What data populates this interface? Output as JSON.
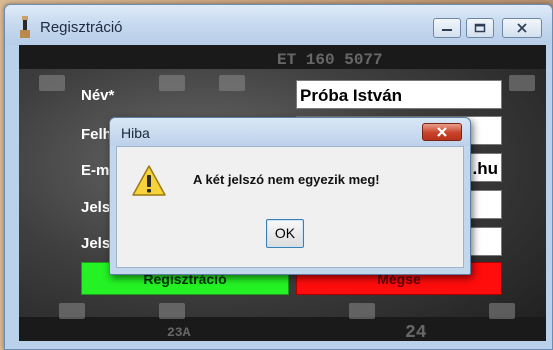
{
  "window": {
    "title": "Regisztráció",
    "icon": "app-icon"
  },
  "form": {
    "fields": [
      {
        "label": "Név*",
        "value": "Próba István"
      },
      {
        "label": "Felh",
        "value": ""
      },
      {
        "label": "E-m",
        "value": ".hu"
      },
      {
        "label": "Jels",
        "value": ""
      },
      {
        "label": "Jels",
        "value": ""
      }
    ],
    "register_button": "Regisztráció",
    "cancel_button": "Mégse"
  },
  "background": {
    "film_code_top": "ET 160 5077",
    "film_code_bottom_left": "23A",
    "film_code_bottom_right": "24"
  },
  "dialog": {
    "title": "Hiba",
    "message": "A két jelszó nem egyezik meg!",
    "ok_label": "OK",
    "icon": "warning-icon"
  },
  "colors": {
    "register": "#24f224",
    "cancel": "#ff0c0c",
    "dialog_close": "#c7432a"
  }
}
